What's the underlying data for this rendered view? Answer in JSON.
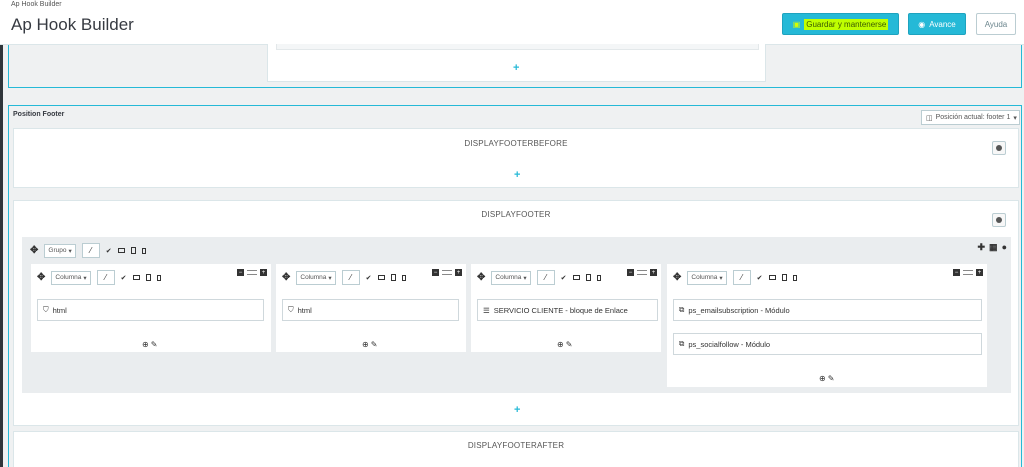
{
  "breadcrumb": "Ap Hook Builder",
  "title": "Ap Hook Builder",
  "buttons": {
    "save": "Guardar y mantenerse",
    "preview": "Avance",
    "help": "Ayuda"
  },
  "position": {
    "title": "Position Footer",
    "current": "Posición actual: footer 1"
  },
  "hooks": {
    "before": "DISPLAYFOOTERBEFORE",
    "main": "DISPLAYFOOTER",
    "after": "DISPLAYFOOTERAFTER"
  },
  "group": {
    "select": "Grupo"
  },
  "columns": [
    {
      "select": "Columna",
      "widgets": [
        "html"
      ]
    },
    {
      "select": "Columna",
      "widgets": [
        "html"
      ]
    },
    {
      "select": "Columna",
      "widgets": [
        "SERVICIO CLIENTE - bloque de Enlace"
      ]
    },
    {
      "select": "Columna",
      "widgets": [
        "ps_emailsubscription - Módulo",
        "ps_socialfollow - Módulo"
      ]
    }
  ],
  "icons": [
    "move-icon",
    "magic-wand-icon",
    "check-icon",
    "desktop-icon",
    "tablet-icon",
    "phone-icon",
    "gear-icon",
    "plus-icon",
    "grid-icon",
    "pencil-icon",
    "html5-icon",
    "list-icon",
    "module-icon"
  ]
}
